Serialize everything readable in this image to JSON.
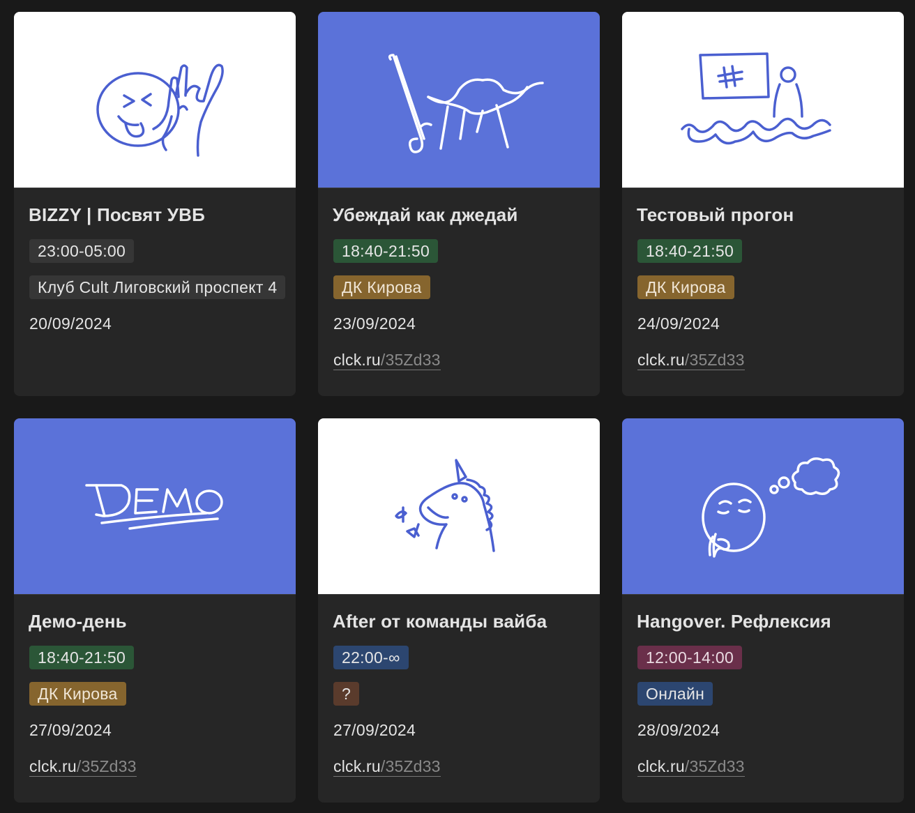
{
  "cards": [
    {
      "title": "BIZZY | Посвят УВБ",
      "time": "23:00-05:00",
      "location": "Клуб Cult Лиговский проспект 4",
      "date": "20/09/2024",
      "icon": "rock-hand-face-icon"
    },
    {
      "title": "Убеждай как джедай",
      "time": "18:40-21:50",
      "location": "ДК Кирова",
      "date": "23/09/2024",
      "link_host": "clck.ru",
      "link_path": "/35Zd33",
      "icon": "yoda-icon"
    },
    {
      "title": "Тестовый прогон",
      "time": "18:40-21:50",
      "location": "ДК Кирова",
      "date": "24/09/2024",
      "link_host": "clck.ru",
      "link_path": "/35Zd33",
      "icon": "presentation-audience-icon"
    },
    {
      "title": "Демо-день",
      "time": "18:40-21:50",
      "location": "ДК Кирова",
      "date": "27/09/2024",
      "link_host": "clck.ru",
      "link_path": "/35Zd33",
      "icon": "demo-lettering-icon"
    },
    {
      "title": "After от команды вайба",
      "time": "22:00-∞",
      "location": "?",
      "date": "27/09/2024",
      "link_host": "clck.ru",
      "link_path": "/35Zd33",
      "icon": "unicorn-icon"
    },
    {
      "title": "Hangover. Рефлексия",
      "time": "12:00-14:00",
      "location": "Онлайн",
      "date": "28/09/2024",
      "link_host": "clck.ru",
      "link_path": "/35Zd33",
      "icon": "thinking-face-icon"
    }
  ],
  "colors": {
    "background": "#191919",
    "card": "#262626",
    "cover_blue": "#5b72d9",
    "ink_blue": "#4a5fd0",
    "tag_green": "#2b5637",
    "tag_gold": "#86652e",
    "tag_navy": "#2c4670",
    "tag_brown": "#5a3b2c",
    "tag_plum": "#6a2f4a",
    "tag_gray": "#363636"
  }
}
